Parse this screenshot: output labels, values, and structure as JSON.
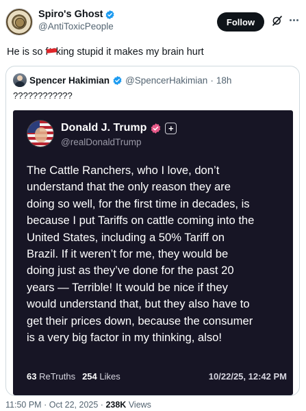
{
  "author": {
    "display_name": "Spiro's Ghost",
    "handle": "@AntiToxicPeople"
  },
  "actions": {
    "follow_label": "Follow"
  },
  "post": {
    "text_before": "He is so f",
    "text_censored": "**",
    "text_after": "king stupid it makes my brain hurt"
  },
  "quoted": {
    "display_name": "Spencer Hakimian",
    "handle": "@SpencerHakimian",
    "separator": "·",
    "time": "18h",
    "text": "????????????"
  },
  "truth_card": {
    "display_name": "Donald J. Trump",
    "handle": "@realDonaldTrump",
    "plus_label": "+",
    "body_lines": [
      "The Cattle Ranchers, who I love, don’t",
      "understand that the only reason they are",
      "doing so well, for the first time in decades, is",
      "because I put Tariffs on cattle coming into the",
      "United States, including a 50% Tariff on",
      "Brazil. If it weren’t for me, they would be",
      "doing just as they’ve done for the past 20",
      "years — Terrible! It would be nice if they",
      "would understand that, but they also have to",
      "get their prices down, because the consumer",
      "is a very big factor in my thinking, also!"
    ],
    "retruths_count": "63",
    "retruths_label": "ReTruths",
    "likes_count": "254",
    "likes_label": "Likes",
    "date": "10/22/25, 12:42 PM"
  },
  "meta": {
    "time": "11:50 PM",
    "separator": "·",
    "date": "Oct 22, 2025",
    "views_count": "238K",
    "views_label": "Views"
  },
  "colors": {
    "verified_blue": "#1d9bf0",
    "truth_badge_pink": "#e85a8a",
    "card_bg": "#171525",
    "follow_bg": "#0f1419",
    "censor_red": "#e0262a"
  },
  "icons": {
    "verified": "verified-badge-icon",
    "grok": "grok-icon",
    "more": "more-options-icon",
    "truth_verified": "truth-verified-badge-icon"
  }
}
